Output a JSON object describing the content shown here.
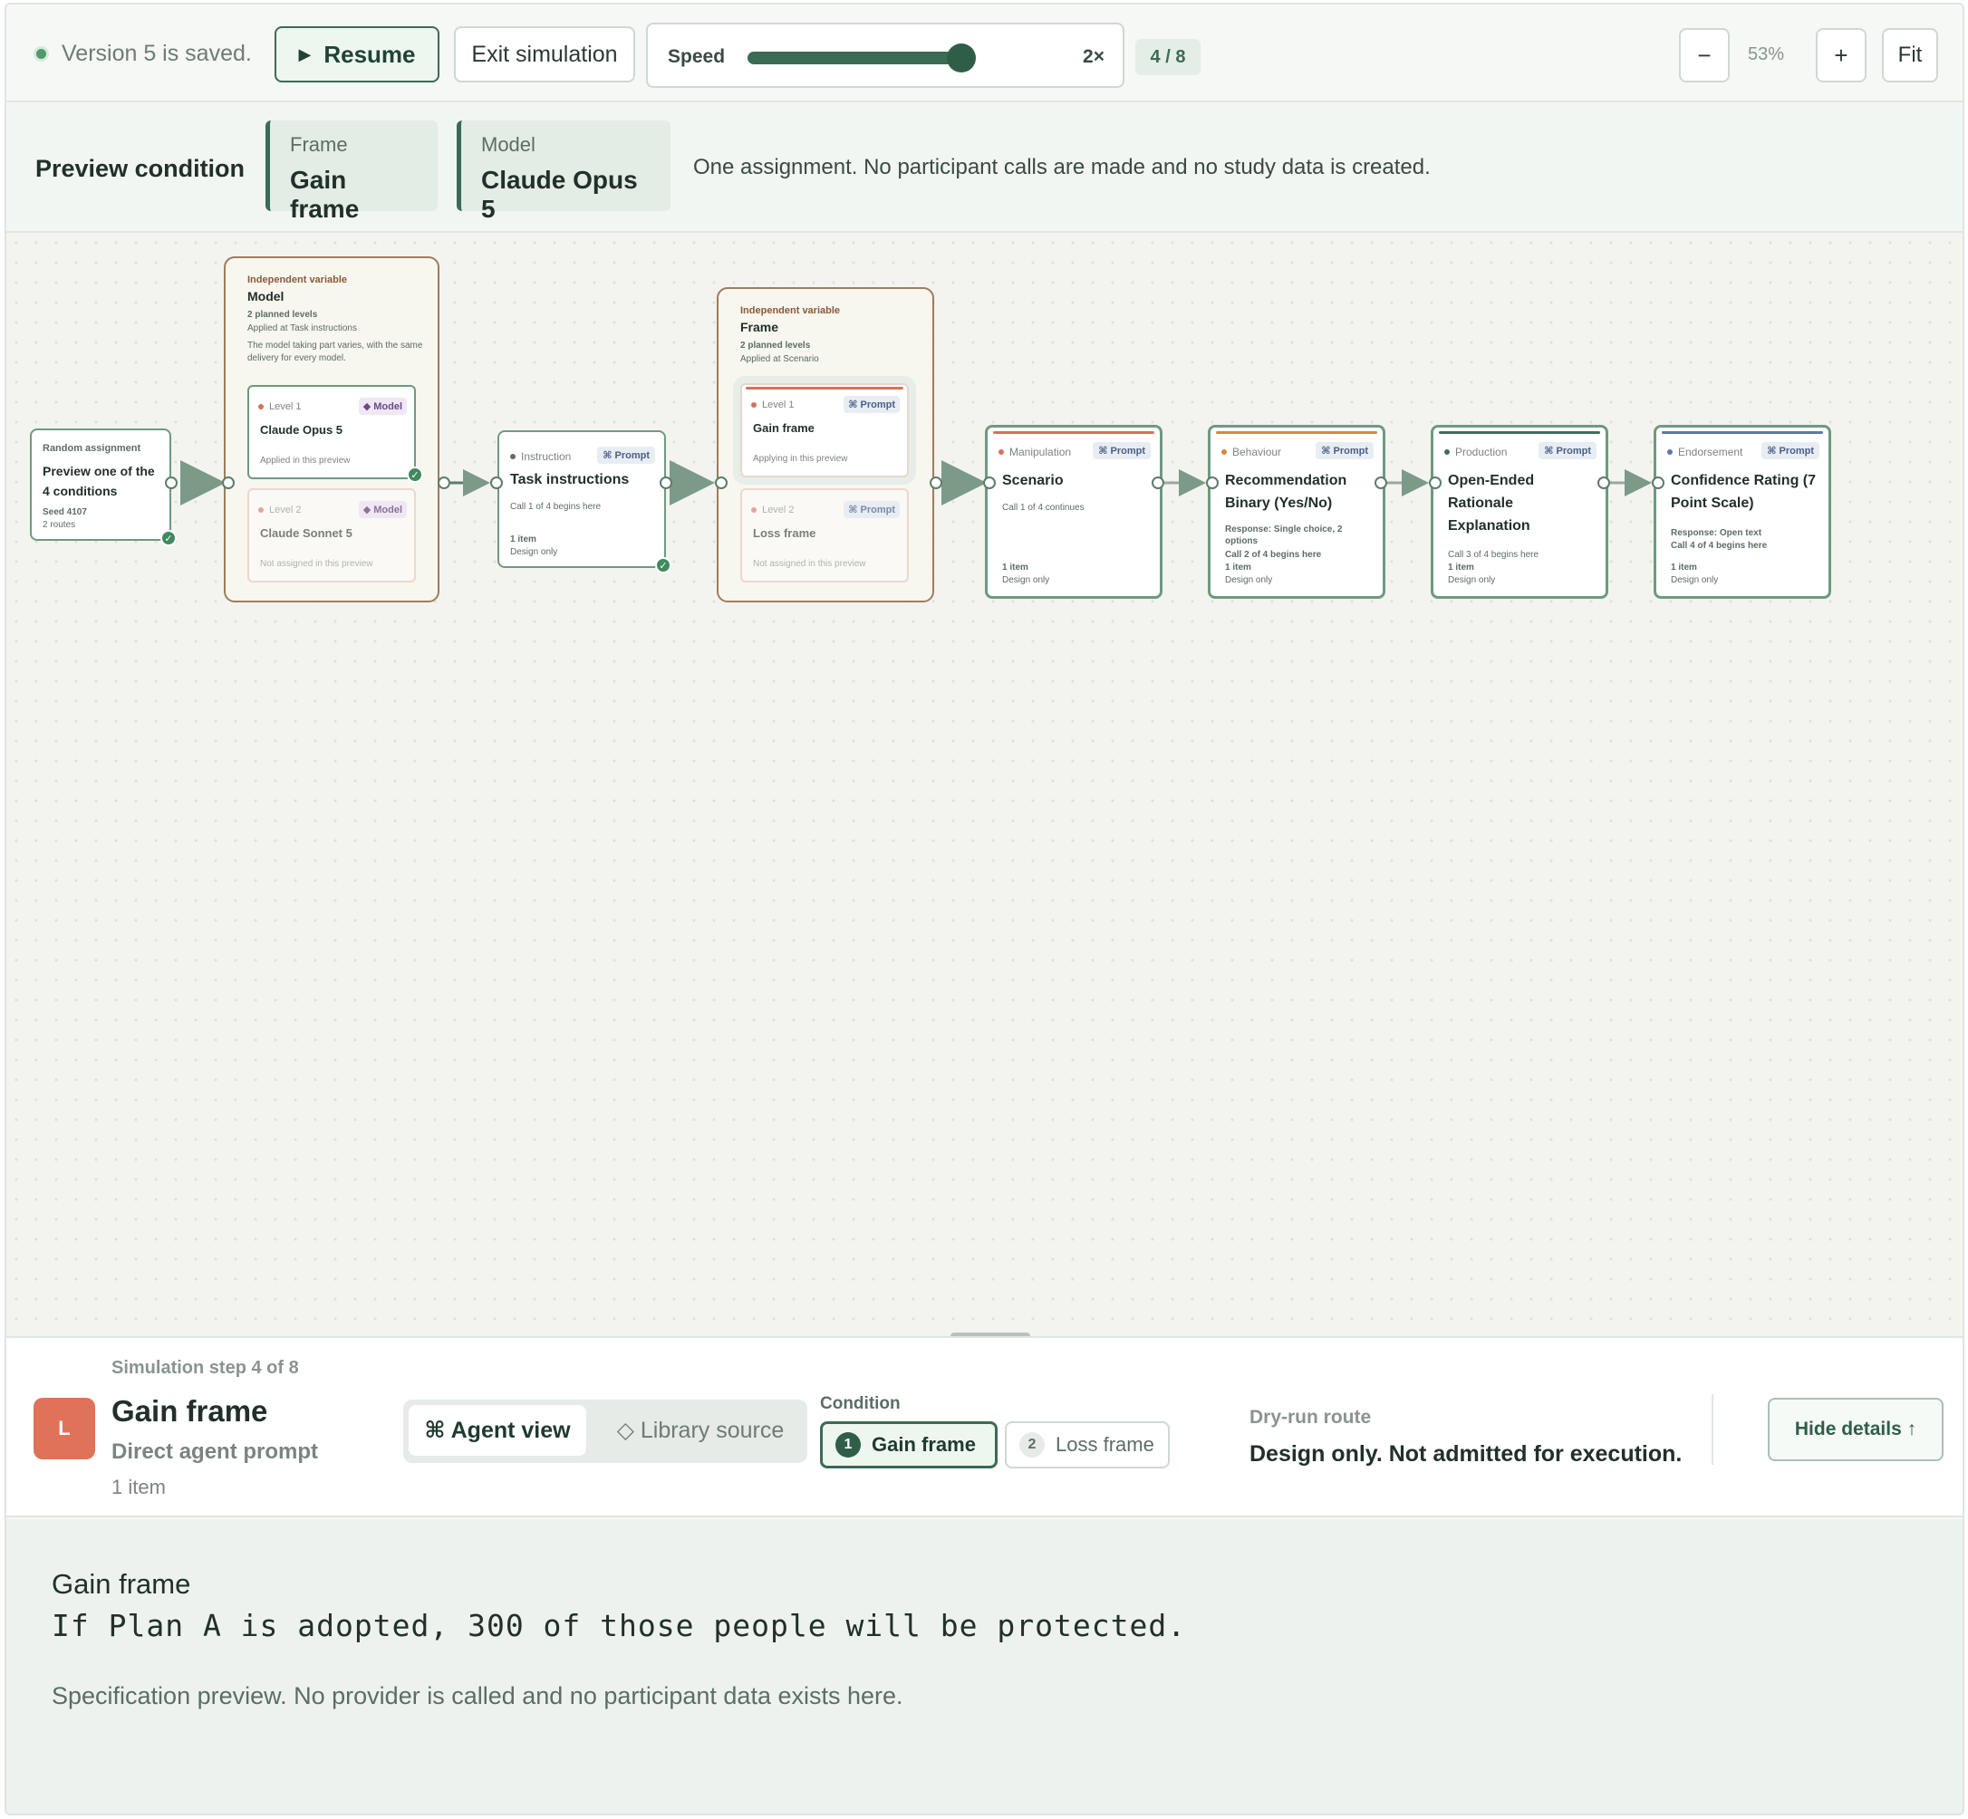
{
  "toolbar": {
    "saved_status": "Version 5 is saved.",
    "resume_label": "Resume",
    "exit_label": "Exit simulation",
    "speed_label": "Speed",
    "speed_value": "2×",
    "speed_level": 0.83,
    "step_counter": "4 / 8",
    "zoom_out": "−",
    "zoom_level": "53%",
    "zoom_in": "+",
    "fit_label": "Fit"
  },
  "preview": {
    "title": "Preview condition",
    "chips": [
      {
        "key": "Frame",
        "value": "Gain frame"
      },
      {
        "key": "Model",
        "value": "Claude Opus 5"
      }
    ],
    "note": "One assignment. No participant calls are made and no study data is created."
  },
  "canvas": {
    "random": {
      "kind": "Random assignment",
      "title": "Preview one of the 4 conditions",
      "seed": "Seed 4107",
      "routes": "2 routes"
    },
    "model_group": {
      "kind": "Independent variable",
      "title": "Model",
      "levels_count": "2 planned levels",
      "applied": "Applied at Task instructions",
      "desc": "The model taking part varies, with the same delivery for every model.",
      "levels": [
        {
          "level": "Level 1",
          "tag": "◆ Model",
          "name": "Claude Opus 5",
          "status": "Applied in this preview"
        },
        {
          "level": "Level 2",
          "tag": "◆ Model",
          "name": "Claude Sonnet 5",
          "status": "Not assigned in this preview"
        }
      ]
    },
    "instruction": {
      "kind": "Instruction",
      "tag": "⌘ Prompt",
      "title": "Task instructions",
      "call": "Call 1 of 4 begins here",
      "items": "1 item",
      "mode": "Design only"
    },
    "frame_group": {
      "kind": "Independent variable",
      "title": "Frame",
      "levels_count": "2 planned levels",
      "applied": "Applied at Scenario",
      "levels": [
        {
          "level": "Level 1",
          "tag": "⌘ Prompt",
          "name": "Gain frame",
          "status": "Applying in this preview"
        },
        {
          "level": "Level 2",
          "tag": "⌘ Prompt",
          "name": "Loss frame",
          "status": "Not assigned in this preview"
        }
      ]
    },
    "steps": [
      {
        "kind": "Manipulation",
        "tag": "⌘ Prompt",
        "title": "Scenario",
        "response": "",
        "call": "Call 1 of 4 continues",
        "items": "1 item",
        "mode": "Design only",
        "color": "#d4725a"
      },
      {
        "kind": "Behaviour",
        "tag": "⌘ Prompt",
        "title": "Recommendation Binary (Yes/No)",
        "response": "Response: Single choice, 2 options",
        "call": "Call 2 of 4 begins here",
        "items": "1 item",
        "mode": "Design only",
        "color": "#d48a3a"
      },
      {
        "kind": "Production",
        "tag": "⌘ Prompt",
        "title": "Open-Ended Rationale Explanation",
        "response": "",
        "call": "Call 3 of 4 begins here",
        "items": "1 item",
        "mode": "Design only",
        "color": "#3f6e5a"
      },
      {
        "kind": "Endorsement",
        "tag": "⌘ Prompt",
        "title": "Confidence Rating (7 Point Scale)",
        "response": "Response: Open text",
        "call": "Call 4 of 4 begins here",
        "items": "1 item",
        "mode": "Design only",
        "color": "#5a7aa8"
      }
    ]
  },
  "panel": {
    "step_label": "Simulation step 4 of 8",
    "avatar": "L",
    "title": "Gain frame",
    "subtitle": "Direct agent prompt",
    "items": "1 item",
    "view_active": "⌘ Agent view",
    "view_inactive": "◇ Library source",
    "condition_label": "Condition",
    "conditions": [
      {
        "num": "1",
        "label": "Gain frame"
      },
      {
        "num": "2",
        "label": "Loss frame"
      }
    ],
    "route_label": "Dry-run route",
    "route_value": "Design only. Not admitted for execution.",
    "hide_label": "Hide details ↑"
  },
  "prompt": {
    "label": "Gain frame",
    "text": "If Plan A is adopted, 300 of those people will be protected.",
    "note": "Specification preview. No provider is called and no participant data exists here."
  },
  "colors": {
    "accent": "#3b6b55",
    "avatar": "#e07258",
    "group_border": "#a07c5c"
  }
}
